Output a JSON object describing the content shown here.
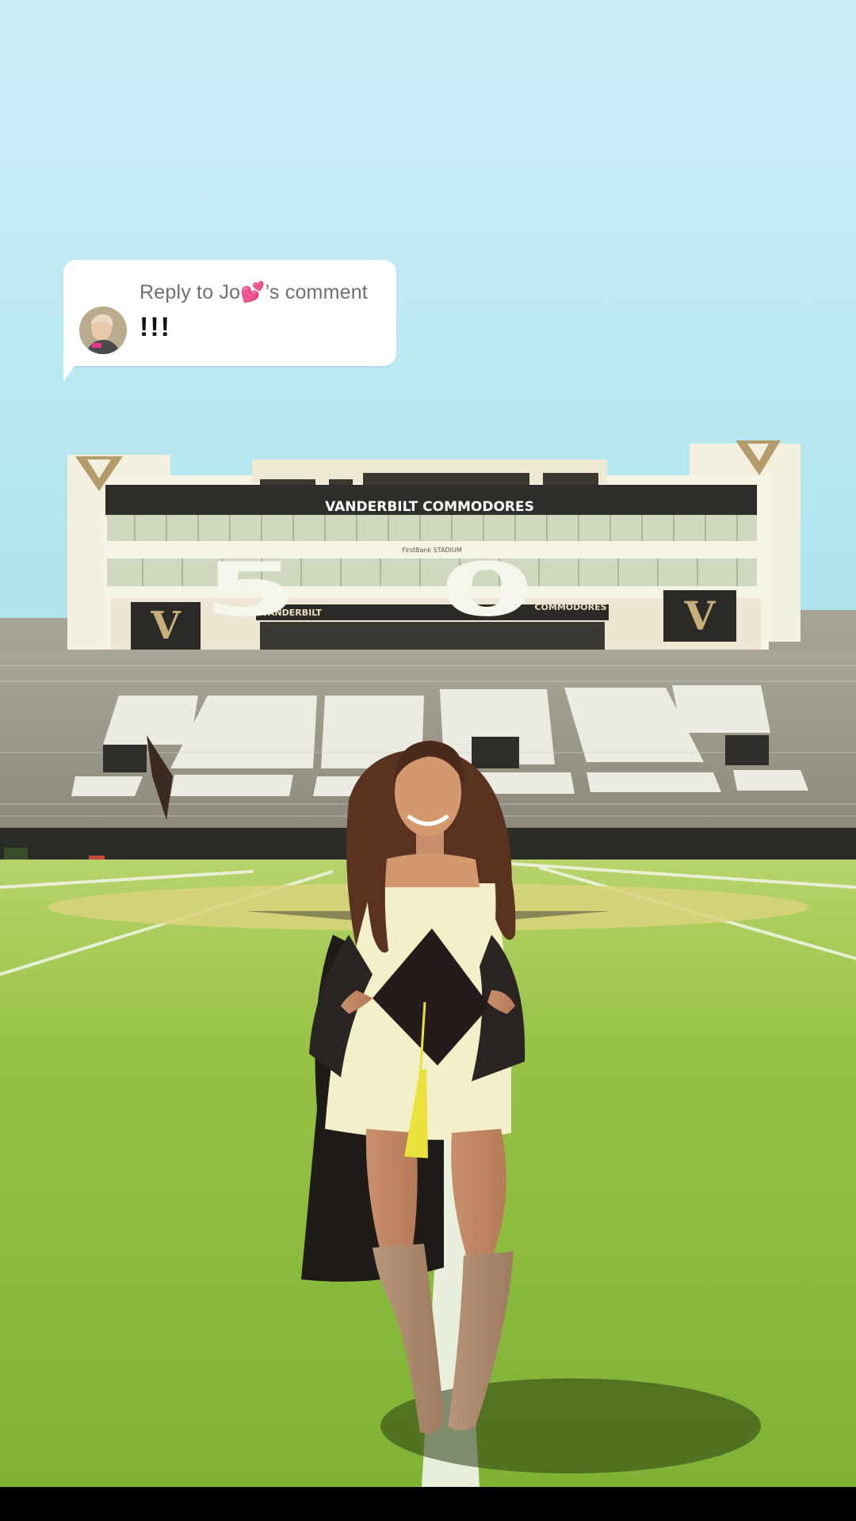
{
  "reply_card": {
    "prefix": "Reply to Jo",
    "heart": "💕",
    "suffix": "’s comment",
    "comment": "!!!",
    "avatar_icon": "user-avatar"
  },
  "stadium": {
    "banner": "VANDERBILT COMMODORES",
    "press_box_sign": "FirstBank STADIUM",
    "left_sign": "VANDERBILT",
    "right_sign": "COMMODORES",
    "logo_letter": "V",
    "yard_marker": "50"
  },
  "colors": {
    "sky_top": "#cdeff7",
    "sky_bottom": "#a9e2ee",
    "grass": "#8fbf3a",
    "stadium_gold": "#b49b6b",
    "bubble_bg": "#ffffff"
  }
}
